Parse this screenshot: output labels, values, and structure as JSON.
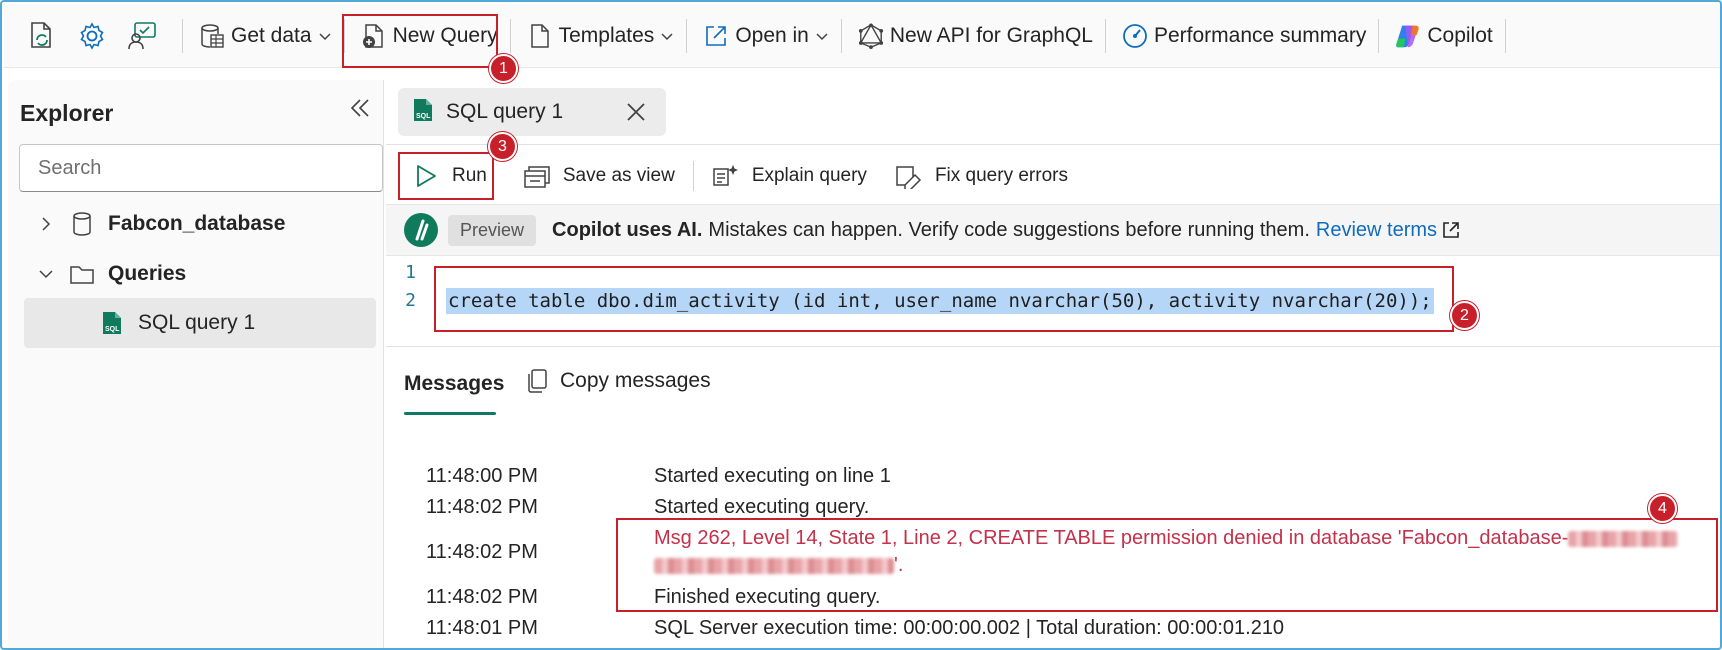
{
  "ribbon": {
    "get_data": "Get data",
    "new_query": "New Query",
    "templates": "Templates",
    "open_in": "Open in",
    "new_api": "New API for GraphQL",
    "performance": "Performance summary",
    "copilot": "Copilot"
  },
  "explorer": {
    "title": "Explorer",
    "search_placeholder": "Search",
    "items": [
      {
        "label": "Fabcon_database",
        "icon": "database-icon",
        "expanded": false
      },
      {
        "label": "Queries",
        "icon": "folder-icon",
        "expanded": true
      },
      {
        "label": "SQL query 1",
        "icon": "sql-file-icon",
        "selected": true
      }
    ]
  },
  "editor": {
    "tab_label": "SQL query 1",
    "toolbar": {
      "run": "Run",
      "save_as_view": "Save as view",
      "explain_query": "Explain query",
      "fix_errors": "Fix query errors"
    },
    "copilot_banner": {
      "preview": "Preview",
      "bold": "Copilot uses AI.",
      "text": "Mistakes can happen. Verify code suggestions before running them.",
      "link": "Review terms"
    },
    "code": {
      "line_numbers": [
        "1",
        "2"
      ],
      "line2": "create table dbo.dim_activity (id int, user_name nvarchar(50), activity nvarchar(20));"
    }
  },
  "messages": {
    "tab": "Messages",
    "copy": "Copy messages",
    "rows": [
      {
        "time": "11:48:00 PM",
        "text": "Started executing on line 1"
      },
      {
        "time": "11:48:02 PM",
        "text": "Started executing query."
      },
      {
        "time": "11:48:02 PM",
        "text": "Msg 262, Level 14, State 1, Line 2, CREATE TABLE permission denied in database 'Fabcon_database-",
        "text_cont": "'.",
        "error": true
      },
      {
        "time": "11:48:02 PM",
        "text": "Finished executing query."
      },
      {
        "time": "11:48:01 PM",
        "text": "SQL Server execution time: 00:00:00.002 | Total duration: 00:00:01.210"
      }
    ]
  },
  "annotations": {
    "badge1": "1",
    "badge2": "2",
    "badge3": "3",
    "badge4": "4",
    "color": "#c8202b"
  }
}
